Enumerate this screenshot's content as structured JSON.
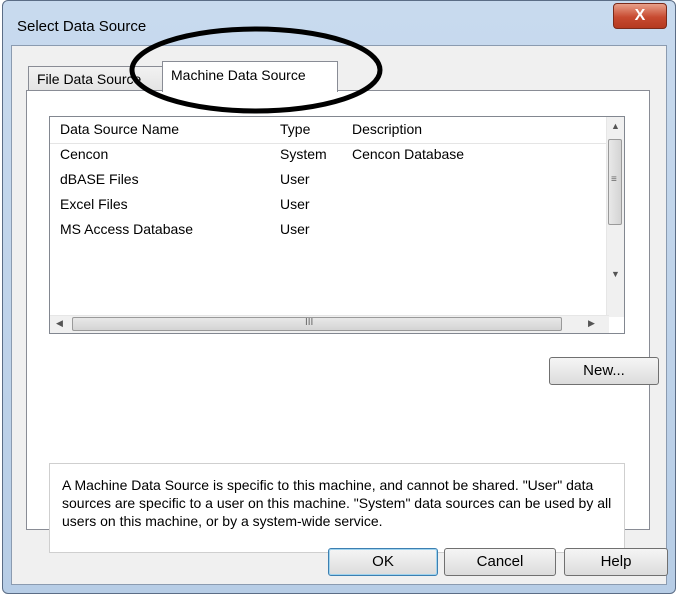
{
  "window": {
    "title": "Select Data Source",
    "close_glyph": "X"
  },
  "tabs": [
    {
      "label": "File Data Source",
      "active": false
    },
    {
      "label": "Machine Data Source",
      "active": true
    }
  ],
  "list": {
    "columns": [
      "Data Source Name",
      "Type",
      "Description"
    ],
    "rows": [
      {
        "name": "Cencon",
        "type": "System",
        "description": "Cencon Database"
      },
      {
        "name": "dBASE Files",
        "type": "User",
        "description": ""
      },
      {
        "name": "Excel Files",
        "type": "User",
        "description": ""
      },
      {
        "name": "MS Access Database",
        "type": "User",
        "description": ""
      }
    ],
    "hscroll_grip": "III",
    "vscroll_grip": "≡"
  },
  "buttons": {
    "new": "New...",
    "ok": "OK",
    "cancel": "Cancel",
    "help": "Help"
  },
  "description": "A Machine Data Source is specific to this machine, and cannot be shared. \"User\" data sources are specific to a user on this machine.  \"System\" data sources can be used by all users on this machine, or by a system-wide service.",
  "colors": {
    "annotation": "#000000",
    "title_bar": "#c8daee",
    "close_button": "#c74a30"
  }
}
